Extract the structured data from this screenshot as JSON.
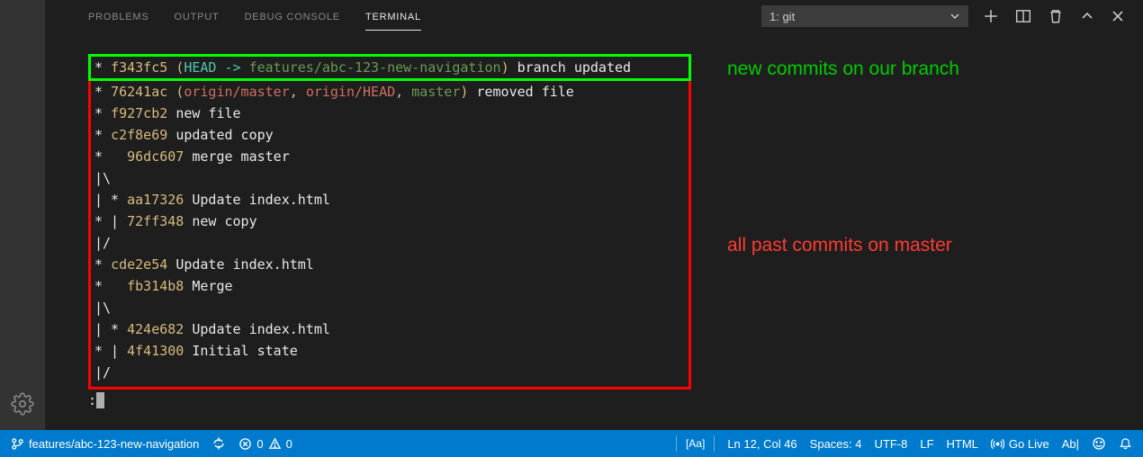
{
  "tabs": {
    "problems": "PROBLEMS",
    "output": "OUTPUT",
    "debug": "DEBUG CONSOLE",
    "terminal": "TERMINAL"
  },
  "dropdown": {
    "value": "1: git"
  },
  "annotations": {
    "green": "new commits on our branch",
    "red": "all past commits on master"
  },
  "log": {
    "l1": {
      "graph": "*",
      "hash": "f343fc5",
      "paren_open": "(",
      "head": "HEAD -> ",
      "branch": "features/abc-123-new-navigation",
      "paren_close": ")",
      "msg": "branch updated"
    },
    "l2": {
      "graph": "*",
      "hash": "76241ac",
      "paren_open": "(",
      "ref1": "origin/master",
      "sep1": ", ",
      "ref2": "origin/HEAD",
      "sep2": ", ",
      "ref3": "master",
      "paren_close": ")",
      "msg": "removed file"
    },
    "l3": {
      "graph": "*",
      "hash": "f927cb2",
      "msg": "new file"
    },
    "l4": {
      "graph": "*",
      "hash": "c2f8e69",
      "msg": "updated copy"
    },
    "l5": {
      "graph": "*  ",
      "hash": "96dc607",
      "msg": "merge master"
    },
    "l6": {
      "graph": "|\\"
    },
    "l7": {
      "graph": "| *",
      "hash": "aa17326",
      "msg": "Update index.html"
    },
    "l8": {
      "graph": "* |",
      "hash": "72ff348",
      "msg": "new copy"
    },
    "l9": {
      "graph": "|/"
    },
    "l10": {
      "graph": "*",
      "hash": "cde2e54",
      "msg": "Update index.html"
    },
    "l11": {
      "graph": "*  ",
      "hash": "fb314b8",
      "msg": "Merge"
    },
    "l12": {
      "graph": "|\\"
    },
    "l13": {
      "graph": "| *",
      "hash": "424e682",
      "msg": "Update index.html"
    },
    "l14": {
      "graph": "* |",
      "hash": "4f41300",
      "msg": "Initial state"
    },
    "l15": {
      "graph": "|/"
    },
    "prompt": ":"
  },
  "status": {
    "branch": "features/abc-123-new-navigation",
    "errors": "0",
    "warnings": "0",
    "aa": "[Aa]",
    "lncol": "Ln 12, Col 46",
    "spaces": "Spaces: 4",
    "encoding": "UTF-8",
    "eol": "LF",
    "lang": "HTML",
    "golive": "Go Live",
    "ab": "Ab|"
  },
  "colors": {
    "accent": "#007acc",
    "green": "#00ff00",
    "red": "#ff0000"
  }
}
